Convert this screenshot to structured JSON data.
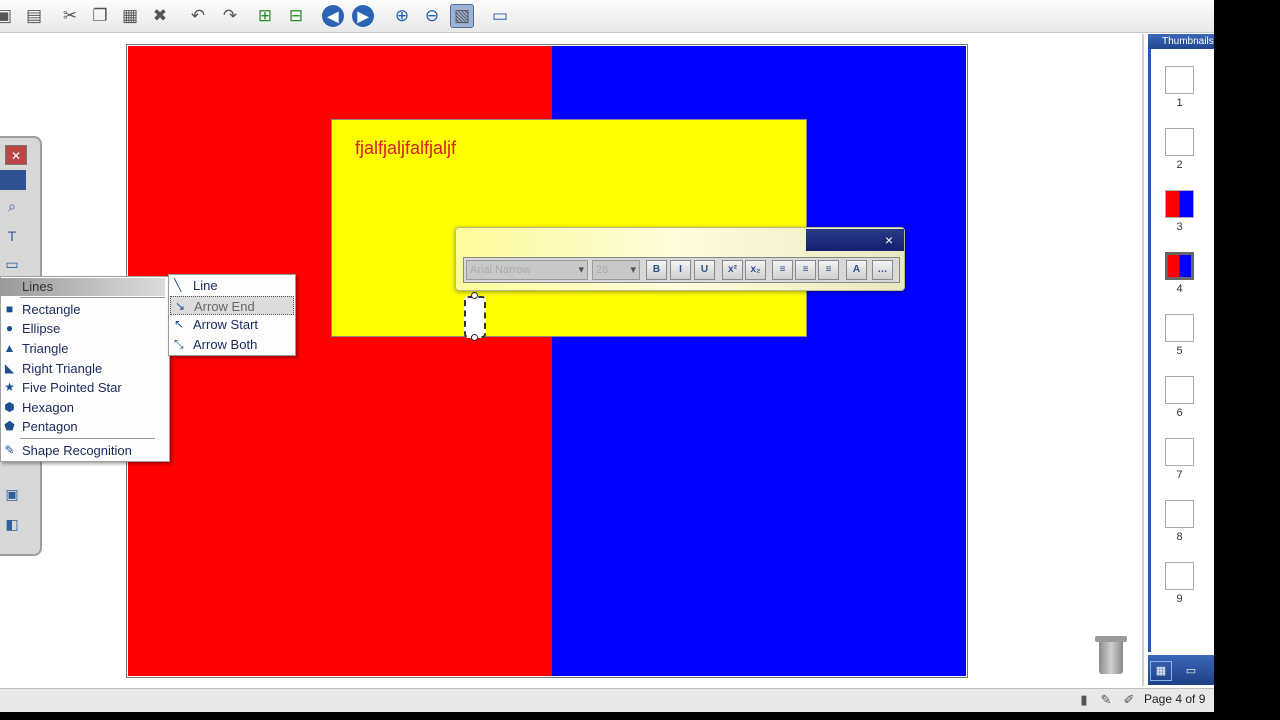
{
  "toolbar": {
    "buttons": [
      {
        "icon": "open-folder-icon",
        "glyph": "▣"
      },
      {
        "icon": "save-icon",
        "glyph": "▤"
      },
      {
        "icon": "cut-icon",
        "glyph": "✂"
      },
      {
        "icon": "copy-icon",
        "glyph": "❐"
      },
      {
        "icon": "paste-icon",
        "glyph": "▦"
      },
      {
        "icon": "delete-icon",
        "glyph": "✖"
      },
      {
        "icon": "undo-icon",
        "glyph": "↶"
      },
      {
        "icon": "redo-icon",
        "glyph": "↷"
      },
      {
        "icon": "insert-blank-page-icon",
        "glyph": "⊞"
      },
      {
        "icon": "duplicate-page-icon",
        "glyph": "⊟"
      },
      {
        "icon": "previous-page-icon",
        "glyph": "◀"
      },
      {
        "icon": "next-page-icon",
        "glyph": "▶"
      },
      {
        "icon": "zoom-in-icon",
        "glyph": "⊕"
      },
      {
        "icon": "zoom-out-icon",
        "glyph": "⊖"
      },
      {
        "icon": "screen-shade-icon",
        "glyph": "▧"
      },
      {
        "icon": "display-settings-icon",
        "glyph": "▭"
      }
    ]
  },
  "canvas": {
    "text_box": "fjalfjaljfalfjaljf",
    "colors": {
      "left_panel": "#ff0000",
      "right_panel": "#0000ff",
      "box": "#ffff00",
      "text": "#d42020"
    }
  },
  "shape_menu": {
    "header": "Lines",
    "items": [
      {
        "label": "Rectangle",
        "icon": "rectangle-icon",
        "glyph": "■"
      },
      {
        "label": "Ellipse",
        "icon": "ellipse-icon",
        "glyph": "●"
      },
      {
        "label": "Triangle",
        "icon": "triangle-icon",
        "glyph": "▲"
      },
      {
        "label": "Right Triangle",
        "icon": "right-triangle-icon",
        "glyph": "◣"
      },
      {
        "label": "Five Pointed Star",
        "icon": "star-icon",
        "glyph": "★"
      },
      {
        "label": "Hexagon",
        "icon": "hexagon-icon",
        "glyph": "⬢"
      },
      {
        "label": "Pentagon",
        "icon": "pentagon-icon",
        "glyph": "⬟"
      }
    ],
    "footer": {
      "label": "Shape Recognition",
      "icon": "shape-recognition-icon",
      "glyph": "✎"
    }
  },
  "line_submenu": {
    "items": [
      {
        "label": "Line",
        "icon": "line-icon",
        "glyph": "╲",
        "highlighted": false
      },
      {
        "label": "Arrow End",
        "icon": "arrow-end-icon",
        "glyph": "↘",
        "highlighted": true
      },
      {
        "label": "Arrow Start",
        "icon": "arrow-start-icon",
        "glyph": "↖",
        "highlighted": false
      },
      {
        "label": "Arrow Both",
        "icon": "arrow-both-icon",
        "glyph": "⤡",
        "highlighted": false
      }
    ]
  },
  "text_toolbar": {
    "font_value": "Arial Narrow",
    "size_value": "28",
    "close": "×"
  },
  "thumbnails": {
    "title": "Thumbnails",
    "pages": [
      "1",
      "2",
      "3",
      "4",
      "5",
      "6",
      "7",
      "8",
      "9"
    ],
    "selected": "4"
  },
  "status": {
    "page_indicator": "Page 4 of 9"
  }
}
